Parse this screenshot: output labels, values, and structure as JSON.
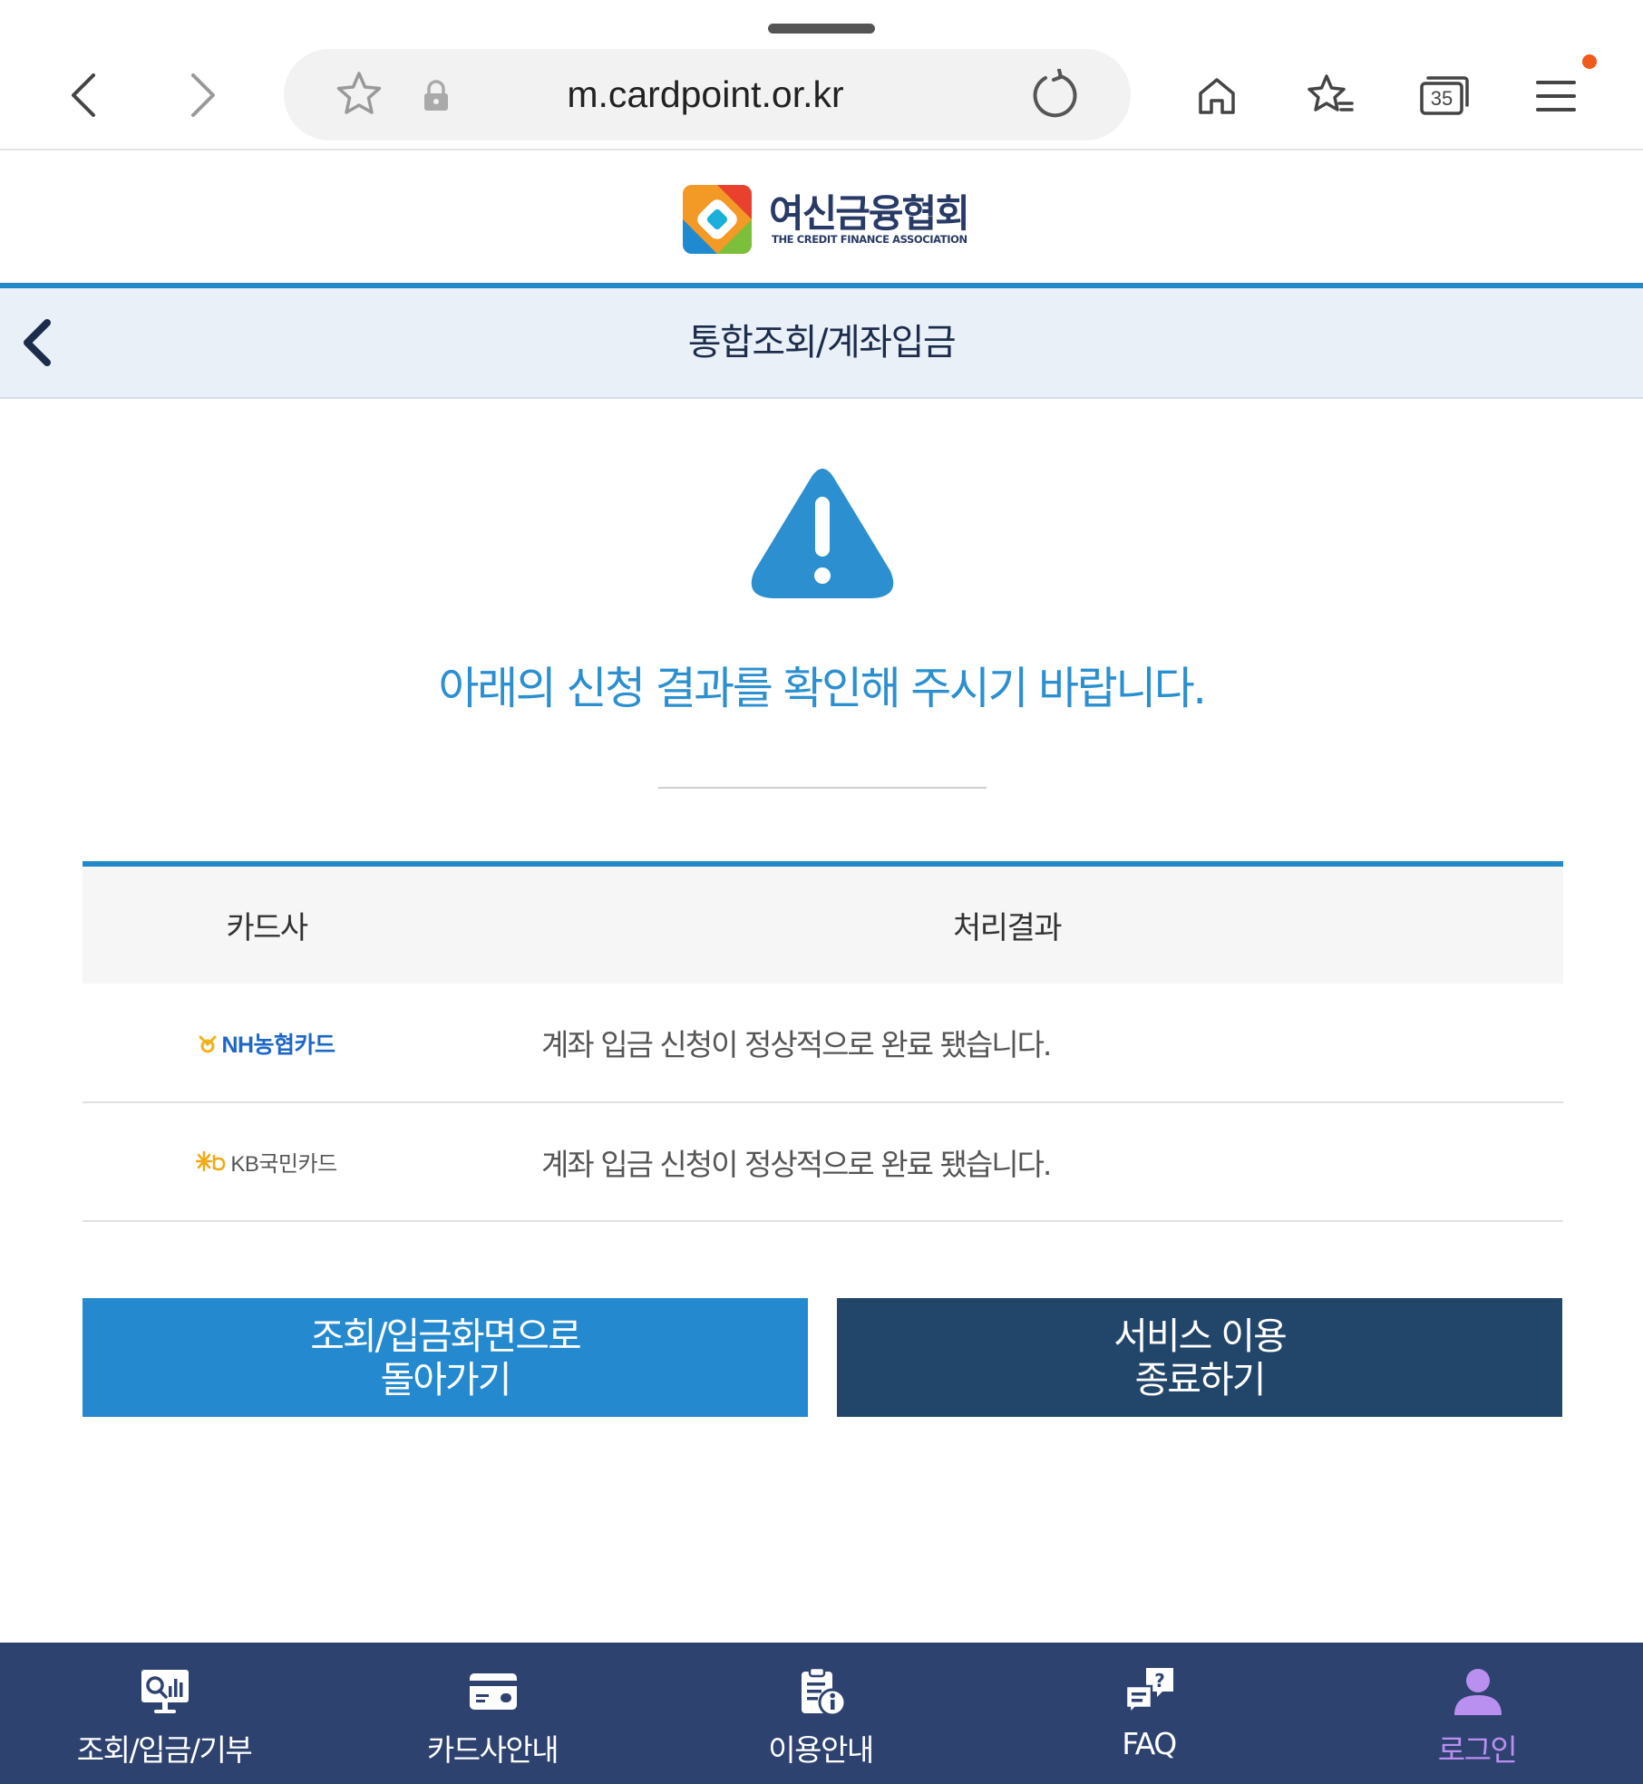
{
  "browser": {
    "url": "m.cardpoint.or.kr",
    "tab_count": "35"
  },
  "site": {
    "logo_ko": "여신금융협회",
    "logo_en": "THE CREDIT FINANCE ASSOCIATION",
    "page_title": "통합조회/계좌입금"
  },
  "notice": {
    "message": "아래의 신청 결과를 확인해 주시기 바랍니다."
  },
  "results": {
    "headers": [
      "카드사",
      "처리결과"
    ],
    "rows": [
      {
        "card": "NH농협카드",
        "result": "계좌 입금 신청이 정상적으로 완료 됐습니다."
      },
      {
        "card": "KB국민카드",
        "result": "계좌 입금 신청이 정상적으로 완료 됐습니다."
      }
    ]
  },
  "buttons": {
    "back_line1": "조회/입금화면으로",
    "back_line2": "돌아가기",
    "exit_line1": "서비스 이용",
    "exit_line2": "종료하기"
  },
  "bottom_nav": [
    {
      "label": "조회/입금/기부",
      "icon": "inquiry-icon"
    },
    {
      "label": "카드사안내",
      "icon": "card-icon"
    },
    {
      "label": "이용안내",
      "icon": "guide-icon"
    },
    {
      "label": "FAQ",
      "icon": "faq-icon"
    },
    {
      "label": "로그인",
      "icon": "user-icon",
      "active": true
    }
  ],
  "colors": {
    "accent_blue": "#2589c9",
    "navy": "#22456a",
    "bottom_nav_bg": "#2e4270",
    "active_nav": "#b98ff0",
    "notif_dot": "#f05a1a"
  }
}
